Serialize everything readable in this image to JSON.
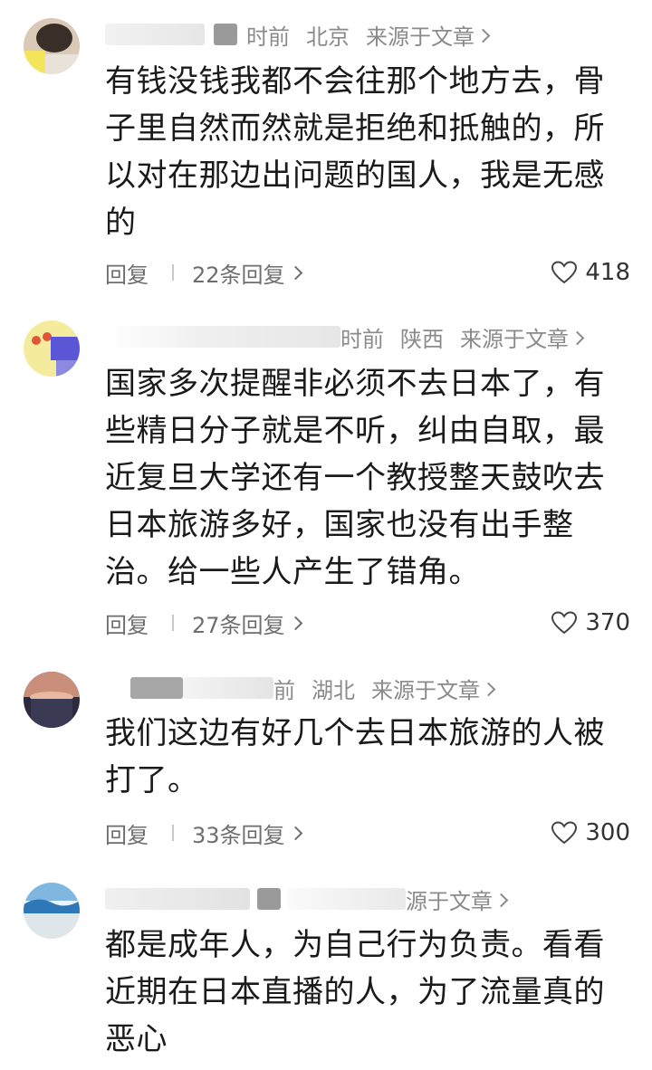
{
  "comments": [
    {
      "meta": {
        "time": "时前",
        "location": "北京",
        "source": "来源于文章"
      },
      "text": "有钱没钱我都不会往那个地方去，骨子里自然而然就是拒绝和抵触的，所以对在那边出问题的国人，我是无感的",
      "actions": {
        "reply": "回复",
        "replies": "22条回复",
        "likes": "418"
      }
    },
    {
      "meta": {
        "time": "时前",
        "location": "陕西",
        "source": "来源于文章"
      },
      "text": "国家多次提醒非必须不去日本了，有些精日分子就是不听，纠由自取，最近复旦大学还有一个教授整天鼓吹去日本旅游多好，国家也没有出手整治。给一些人产生了错角。",
      "actions": {
        "reply": "回复",
        "replies": "27条回复",
        "likes": "370"
      }
    },
    {
      "meta": {
        "time": "前",
        "location": "湖北",
        "source": "来源于文章"
      },
      "text": "我们这边有好几个去日本旅游的人被打了。",
      "actions": {
        "reply": "回复",
        "replies": "33条回复",
        "likes": "300"
      }
    },
    {
      "meta": {
        "source": "源于文章"
      },
      "text": "都是成年人，为自己行为负责。看看近期在日本直播的人，为了流量真的恶心"
    }
  ],
  "colors": {
    "text": "#1a1a1a",
    "meta": "#8a8a8a",
    "action": "#6e6e6e"
  }
}
